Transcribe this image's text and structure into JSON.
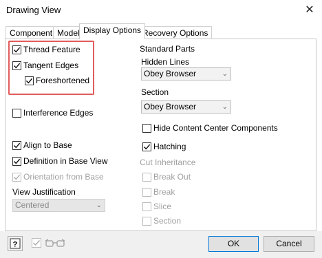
{
  "window": {
    "title": "Drawing View",
    "close_glyph": "✕"
  },
  "tabs": [
    {
      "label": "Component",
      "active": false
    },
    {
      "label": "Model",
      "active": false
    },
    {
      "label": "Display Options",
      "active": true
    },
    {
      "label": "Recovery Options",
      "active": false
    }
  ],
  "left": {
    "thread_feature": {
      "label": "Thread Feature",
      "checked": true
    },
    "tangent_edges": {
      "label": "Tangent Edges",
      "checked": true
    },
    "foreshortened": {
      "label": "Foreshortened",
      "checked": true
    },
    "interference_edges": {
      "label": "Interference Edges",
      "checked": false
    },
    "align_to_base": {
      "label": "Align to Base",
      "checked": true
    },
    "definition_in_base_view": {
      "label": "Definition in Base View",
      "checked": true
    },
    "orientation_from_base": {
      "label": "Orientation from Base",
      "checked": true,
      "disabled": true
    },
    "view_justification": {
      "label": "View Justification",
      "value": "Centered",
      "disabled": true
    }
  },
  "right": {
    "standard_parts": {
      "label": "Standard Parts"
    },
    "hidden_lines": {
      "label": "Hidden Lines",
      "value": "Obey Browser"
    },
    "section": {
      "label": "Section",
      "value": "Obey Browser"
    },
    "hide_content_center": {
      "label": "Hide Content Center Components",
      "checked": false
    },
    "hatching": {
      "label": "Hatching",
      "checked": true
    },
    "cut_inheritance": {
      "label": "Cut Inheritance",
      "items": [
        {
          "label": "Break Out",
          "checked": false
        },
        {
          "label": "Break",
          "checked": false
        },
        {
          "label": "Slice",
          "checked": false
        },
        {
          "label": "Section",
          "checked": false
        }
      ]
    }
  },
  "buttons": {
    "ok": "OK",
    "cancel": "Cancel"
  },
  "icons": {
    "help": "help-icon",
    "glasses": "glasses-icon"
  },
  "colors": {
    "highlight": "#e25c5c",
    "focus_border": "#0078d7"
  }
}
